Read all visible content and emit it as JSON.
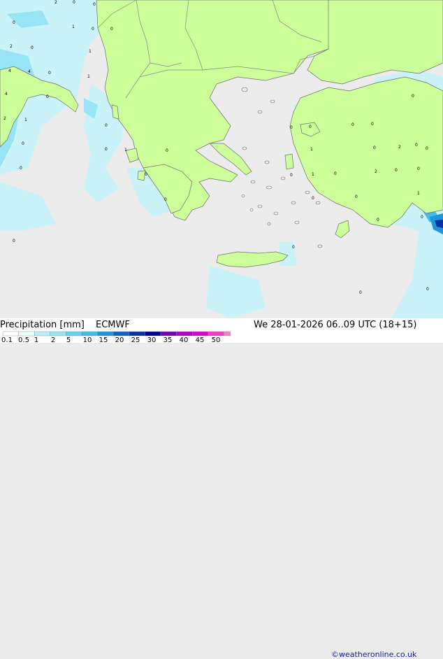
{
  "title": "Precipitation [mm]",
  "model": "ECMWF",
  "valid_time": "We 28-01-2026 06..09 UTC (18+15)",
  "credit": "©weatheronline.co.uk",
  "legend": {
    "ticks": [
      "0.1",
      "0.5",
      "1",
      "2",
      "5",
      "10",
      "15",
      "20",
      "25",
      "30",
      "35",
      "40",
      "45",
      "50"
    ],
    "colors": [
      "#ffffff",
      "#e0ffff",
      "#b4f0fa",
      "#96e6f5",
      "#64d2f0",
      "#3cbee6",
      "#1e96dc",
      "#0a64c8",
      "#0a32a0",
      "#000096",
      "#7800b4",
      "#b400c8",
      "#dc00d2",
      "#f03cc8",
      "#ff78dc"
    ]
  },
  "map_values": [
    "2",
    "0",
    "0",
    "0",
    "1",
    "0",
    "0",
    "2",
    "0",
    "4",
    "4",
    "0",
    "1",
    "1",
    "4",
    "0",
    "1",
    "2",
    "0",
    "0",
    "0",
    "0",
    "1",
    "0",
    "0",
    "0",
    "0",
    "0",
    "0",
    "1",
    "1",
    "0",
    "0",
    "2",
    "0",
    "0",
    "0",
    "2",
    "0",
    "0",
    "0",
    "0",
    "0",
    "0",
    "0",
    "1",
    "0",
    "0",
    "0",
    "0",
    "0"
  ],
  "colors": {
    "land": "#ccff9a",
    "sea": "#ececec",
    "border": "#8a8a8a",
    "coast": "#6f6f6f"
  }
}
